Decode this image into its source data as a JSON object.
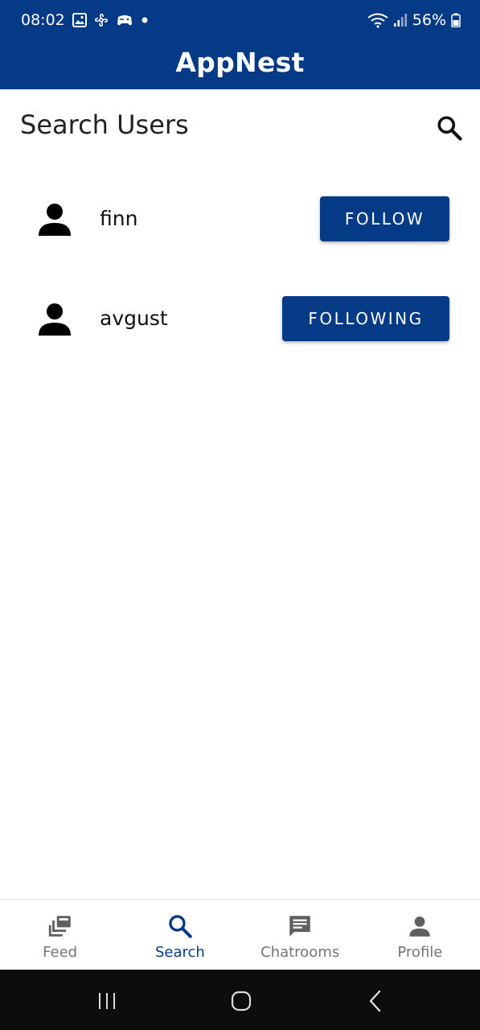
{
  "status_bar": {
    "time": "08:02",
    "battery": "56%",
    "icons": [
      "gallery-icon",
      "pinwheel-icon",
      "game-icon",
      "dot-icon",
      "wifi-icon",
      "signal-icon",
      "battery-icon"
    ]
  },
  "app_bar": {
    "title": "AppNest"
  },
  "search": {
    "title": "Search Users",
    "icon": "search-icon"
  },
  "users": [
    {
      "name": "finn",
      "button": "FOLLOW"
    },
    {
      "name": "avgust",
      "button": "FOLLOWING"
    }
  ],
  "bottom_nav": {
    "items": [
      {
        "label": "Feed",
        "icon": "feed-icon",
        "active": false
      },
      {
        "label": "Search",
        "icon": "search-icon",
        "active": true
      },
      {
        "label": "Chatrooms",
        "icon": "chat-icon",
        "active": false
      },
      {
        "label": "Profile",
        "icon": "person-icon",
        "active": false
      }
    ]
  },
  "colors": {
    "primary": "#053a87",
    "inactive": "#757575",
    "system_nav": "#0d0d0d"
  }
}
